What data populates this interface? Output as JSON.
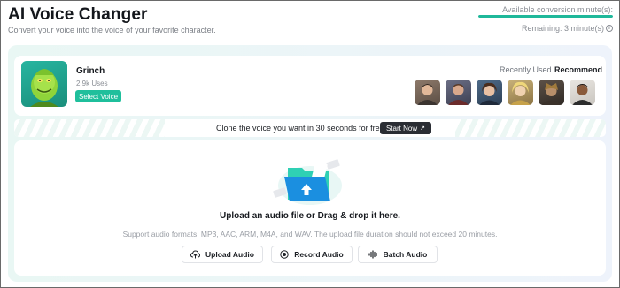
{
  "header": {
    "title": "AI Voice Changer",
    "subtitle": "Convert your voice into the voice of your favorite character.",
    "quota_label": "Available conversion minute(s):",
    "quota_progress": 1.0,
    "remaining": "Remaining: 3 minute(s)",
    "info_glyph": "i"
  },
  "voice": {
    "name": "Grinch",
    "uses": "2.9k Uses",
    "select_label": "Select Voice",
    "tabs": {
      "recent": "Recently Used",
      "recommend": "Recommend"
    },
    "thumbs": [
      "voice-thumb-1",
      "voice-thumb-2",
      "voice-thumb-3",
      "voice-thumb-4",
      "voice-thumb-5",
      "voice-thumb-6"
    ]
  },
  "clone": {
    "text": "Clone the voice you want in 30 seconds for free.",
    "button": "Start Now",
    "button_glyph": "↗"
  },
  "upload": {
    "title": "Upload an audio file or Drag & drop it here.",
    "formats": "Support audio formats: MP3, AAC, ARM, M4A, and WAV. The upload file duration should not exceed 20 minutes.",
    "buttons": {
      "upload": "Upload Audio",
      "record": "Record Audio",
      "batch": "Batch Audio"
    }
  },
  "colors": {
    "accent": "#1fbf9c",
    "dark_button": "#2a2d33",
    "folder_blue": "#1b8fe0",
    "folder_teal": "#2fd0b4"
  }
}
